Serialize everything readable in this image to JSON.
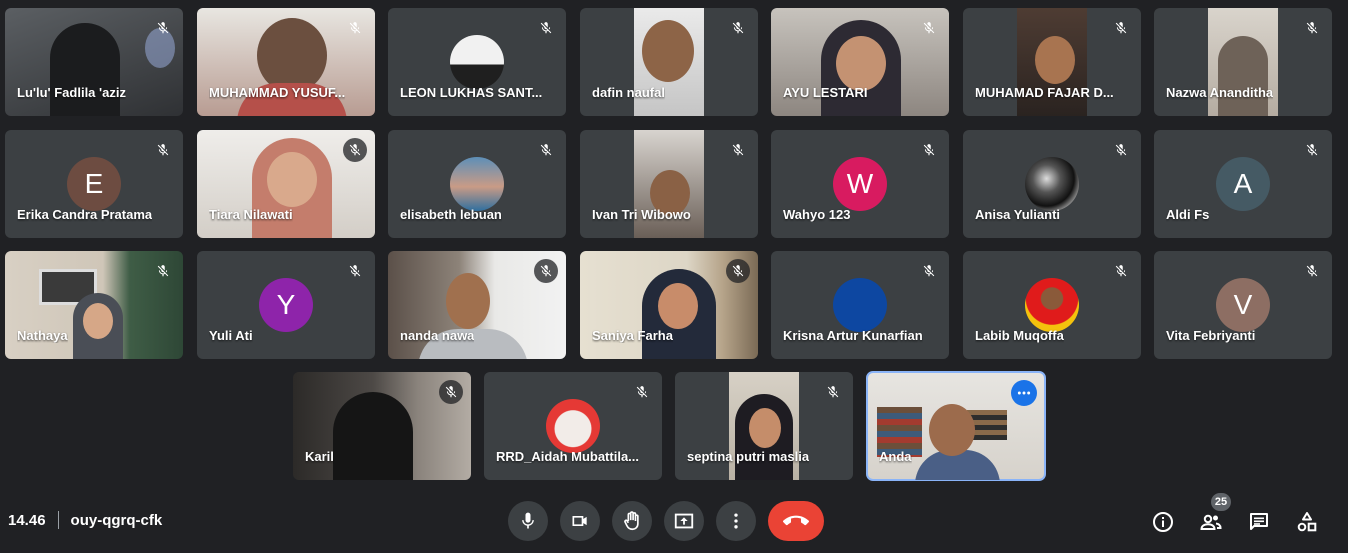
{
  "participants": [
    {
      "name": "Lu'lu' Fadlila 'aziz"
    },
    {
      "name": "MUHAMMAD YUSUF..."
    },
    {
      "name": "LEON LUKHAS SANT..."
    },
    {
      "name": "dafin naufal"
    },
    {
      "name": "AYU LESTARI"
    },
    {
      "name": "MUHAMAD FAJAR D..."
    },
    {
      "name": "Nazwa Ananditha"
    },
    {
      "name": "Erika Candra Pratama",
      "initial": "E",
      "color": "#6d4c41"
    },
    {
      "name": "Tiara Nilawati"
    },
    {
      "name": "elisabeth lebuan"
    },
    {
      "name": "Ivan Tri Wibowo"
    },
    {
      "name": "Wahyo 123",
      "initial": "W",
      "color": "#d81b60"
    },
    {
      "name": "Anisa Yulianti"
    },
    {
      "name": "Aldi Fs",
      "initial": "A",
      "color": "#455a64"
    },
    {
      "name": "Nathaya"
    },
    {
      "name": "Yuli Ati",
      "initial": "Y",
      "color": "#8e24aa"
    },
    {
      "name": "nanda nawa"
    },
    {
      "name": "Saniya Farha"
    },
    {
      "name": "Krisna Artur Kunarfian",
      "color": "#0d47a1"
    },
    {
      "name": "Labib Muqoffa"
    },
    {
      "name": "Vita Febriyanti",
      "initial": "V",
      "color": "#8d6e63"
    },
    {
      "name": "Karil"
    },
    {
      "name": "RRD_Aidah Mubattila..."
    },
    {
      "name": "septina putri maslia"
    },
    {
      "name": "Anda"
    }
  ],
  "meeting": {
    "time": "14.46",
    "code": "ouy-qgrq-cfk"
  },
  "participant_count": "25",
  "colors": {
    "background": "#202124",
    "tile": "#3c4043",
    "end_call": "#ea4335",
    "active_border": "#8ab4f8"
  },
  "icons": [
    "mic-off-icon",
    "mic-icon",
    "camera-icon",
    "raise-hand-icon",
    "present-icon",
    "more-vert-icon",
    "call-end-icon",
    "info-icon",
    "people-icon",
    "chat-icon",
    "activities-icon"
  ]
}
